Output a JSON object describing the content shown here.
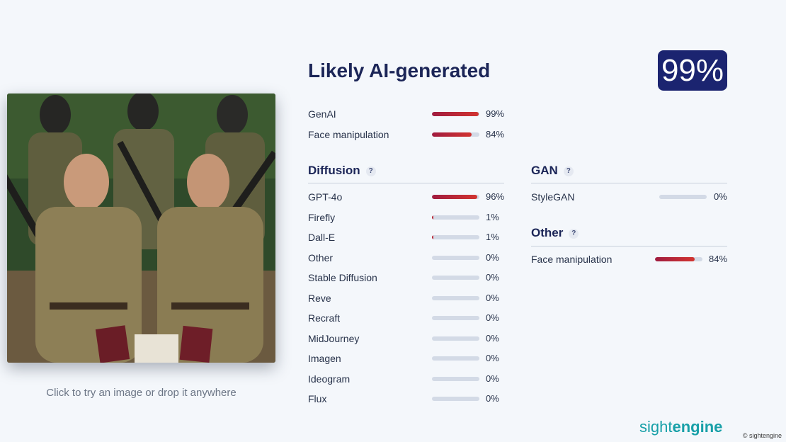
{
  "result": {
    "verdict": "Likely AI-generated",
    "score": "99%"
  },
  "summary": [
    {
      "label": "GenAI",
      "value": 0.99,
      "pct": "99%"
    },
    {
      "label": "Face manipulation",
      "value": 0.84,
      "pct": "84%"
    }
  ],
  "diffusion": {
    "title": "Diffusion",
    "help": "?",
    "items": [
      {
        "label": "GPT-4o",
        "value": 0.96,
        "pct": "96%"
      },
      {
        "label": "Firefly",
        "value": 0.01,
        "pct": "1%"
      },
      {
        "label": "Dall-E",
        "value": 0.01,
        "pct": "1%"
      },
      {
        "label": "Other",
        "value": 0,
        "pct": "0%"
      },
      {
        "label": "Stable Diffusion",
        "value": 0,
        "pct": "0%"
      },
      {
        "label": "Reve",
        "value": 0,
        "pct": "0%"
      },
      {
        "label": "Recraft",
        "value": 0,
        "pct": "0%"
      },
      {
        "label": "MidJourney",
        "value": 0,
        "pct": "0%"
      },
      {
        "label": "Imagen",
        "value": 0,
        "pct": "0%"
      },
      {
        "label": "Ideogram",
        "value": 0,
        "pct": "0%"
      },
      {
        "label": "Flux",
        "value": 0,
        "pct": "0%"
      }
    ]
  },
  "gan": {
    "title": "GAN",
    "help": "?",
    "items": [
      {
        "label": "StyleGAN",
        "value": 0,
        "pct": "0%"
      }
    ]
  },
  "other": {
    "title": "Other",
    "help": "?",
    "items": [
      {
        "label": "Face manipulation",
        "value": 0.84,
        "pct": "84%"
      }
    ]
  },
  "upload_hint": "Click to try an image or drop it anywhere",
  "brand": {
    "part1": "sight",
    "part2": "engine"
  },
  "copyright": "© sightengine",
  "colors": {
    "accent": "#1b2470",
    "bar_fill": "#c0283a",
    "bar_track": "#d3dae6",
    "brand": "#18a0a8"
  }
}
